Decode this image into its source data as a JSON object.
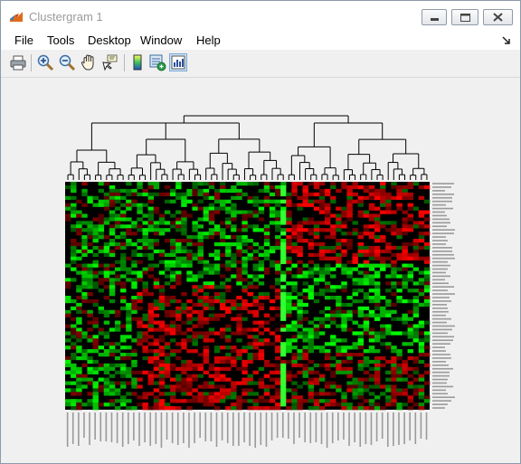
{
  "window": {
    "title": "Clustergram 1",
    "icons": [
      "matlab-figure-icon",
      "minimize-icon",
      "maximize-icon",
      "close-icon"
    ]
  },
  "menubar": {
    "items": [
      {
        "id": "file",
        "label": "File"
      },
      {
        "id": "tools",
        "label": "Tools"
      },
      {
        "id": "desktop",
        "label": "Desktop"
      },
      {
        "id": "window",
        "label": "Window"
      },
      {
        "id": "help",
        "label": "Help"
      }
    ],
    "dock_icon": "dock-arrow-icon"
  },
  "toolbar": {
    "buttons": [
      {
        "name": "print-button",
        "icon": "printer-icon"
      },
      {
        "name": "zoom-in-button",
        "icon": "zoom-in-icon"
      },
      {
        "name": "zoom-out-button",
        "icon": "zoom-out-icon"
      },
      {
        "name": "pan-button",
        "icon": "hand-icon"
      },
      {
        "name": "data-cursor-button",
        "icon": "data-cursor-icon"
      },
      {
        "name": "colorbar-button",
        "icon": "colorbar-icon"
      },
      {
        "name": "dendrogram-color-button",
        "icon": "dendrogram-color-icon"
      },
      {
        "name": "export-to-workspace-button",
        "icon": "export-icon",
        "active": true
      }
    ]
  },
  "clustergram": {
    "colors": {
      "high": "#ff0000",
      "low": "#00ff00",
      "mid": "#000000",
      "dendrogram": "#000000"
    },
    "column_count": 66,
    "row_count": 64,
    "column_split_index": 40
  }
}
